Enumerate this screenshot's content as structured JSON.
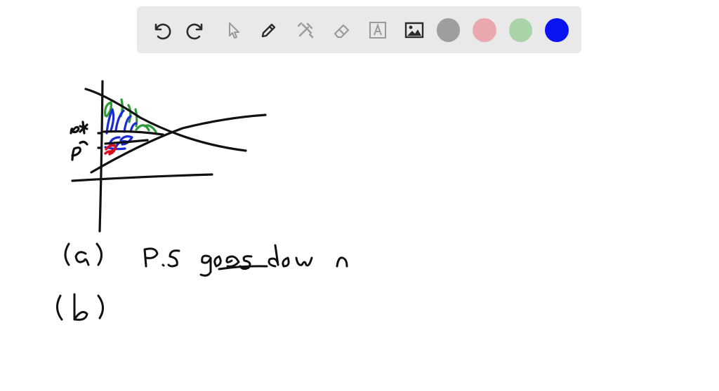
{
  "toolbar": {
    "tools": [
      {
        "name": "undo-icon",
        "enabled": true
      },
      {
        "name": "redo-icon",
        "enabled": true
      },
      {
        "name": "pointer-icon",
        "enabled": false
      },
      {
        "name": "pen-icon",
        "enabled": true
      },
      {
        "name": "tools-icon",
        "enabled": false
      },
      {
        "name": "eraser-icon",
        "enabled": false
      },
      {
        "name": "text-icon",
        "enabled": false
      },
      {
        "name": "image-icon",
        "enabled": true
      }
    ],
    "colors": [
      {
        "name": "gray",
        "hex": "#9e9e9e"
      },
      {
        "name": "pink",
        "hex": "#e8a8ad"
      },
      {
        "name": "green",
        "hex": "#a9d3a9"
      },
      {
        "name": "blue",
        "hex": "#0a14f2"
      }
    ]
  },
  "ink": {
    "black": "#111111",
    "blue": "#1a2ad6",
    "green": "#2f9a3a",
    "red": "#d8101e"
  }
}
